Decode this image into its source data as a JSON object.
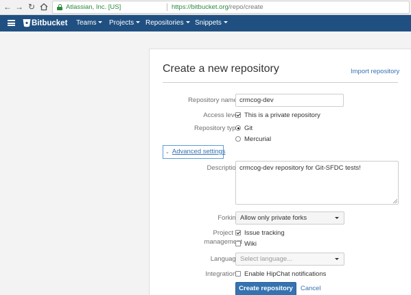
{
  "browser": {
    "org": "Atlassian, Inc. [US]",
    "url_host": "https://bitbucket.org",
    "url_path": "/repo/create"
  },
  "header": {
    "brand": "Bitbucket",
    "menus": [
      "Teams",
      "Projects",
      "Repositories",
      "Snippets"
    ]
  },
  "form": {
    "title": "Create a new repository",
    "import_link": "Import repository",
    "repo_name_label": "Repository name",
    "repo_name_required": "*",
    "repo_name_value": "crmcog-dev",
    "access_label": "Access level",
    "access_private_label": "This is a private repository",
    "access_private_checked": true,
    "type_label": "Repository type",
    "type_options": [
      "Git",
      "Mercurial"
    ],
    "type_selected": "Git",
    "advanced_label": "Advanced settings",
    "description_label": "Description",
    "description_value": "crmcog-dev repository for Git-SFDC tests!",
    "forking_label": "Forking",
    "forking_value": "Allow only private forks",
    "pm_label_line1": "Project",
    "pm_label_line2": "management",
    "pm_issue_label": "Issue tracking",
    "pm_issue_checked": true,
    "pm_wiki_label": "Wiki",
    "pm_wiki_checked": false,
    "language_label": "Language",
    "language_placeholder": "Select language...",
    "integrations_label": "Integrations",
    "hipchat_label": "Enable HipChat notifications",
    "hipchat_checked": false,
    "create_button": "Create repository",
    "cancel_link": "Cancel"
  },
  "colors": {
    "header_bg": "#205081",
    "link": "#3572b0",
    "primary_button": "#3572b0",
    "secure_green": "#2b8a3e",
    "required": "#d04437"
  }
}
